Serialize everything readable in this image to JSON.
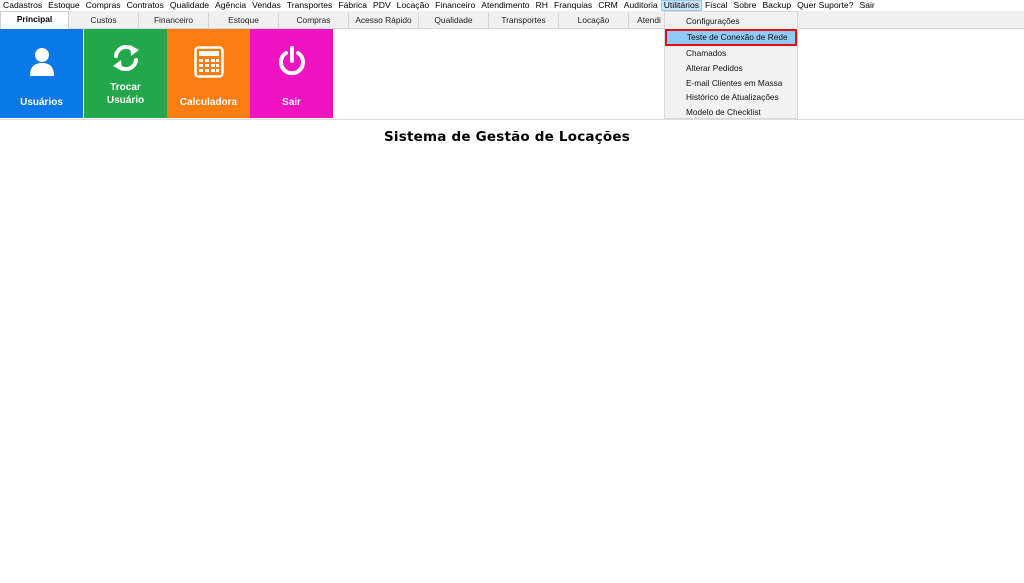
{
  "menu": [
    "Cadastros",
    "Estoque",
    "Compras",
    "Contratos",
    "Qualidade",
    "Agência",
    "Vendas",
    "Transportes",
    "Fábrica",
    "PDV",
    "Locação",
    "Financeiro",
    "Atendimento",
    "RH",
    "Franquias",
    "CRM",
    "Auditoria",
    "Utilitários",
    "Fiscal",
    "Sobre",
    "Backup",
    "Quer Suporte?",
    "Sair"
  ],
  "menu_active_index": 17,
  "tabs": [
    {
      "label": "Principal"
    },
    {
      "label": "Custos"
    },
    {
      "label": "Financeiro"
    },
    {
      "label": "Estoque"
    },
    {
      "label": "Compras"
    },
    {
      "label": "Acesso Rápido"
    },
    {
      "label": "Qualidade"
    },
    {
      "label": "Transportes"
    },
    {
      "label": "Locação"
    },
    {
      "label": "Atendi"
    }
  ],
  "tiles": [
    {
      "label": "Usuários",
      "color": "#0a78e6",
      "icon": "user-icon"
    },
    {
      "label": "Trocar Usuário",
      "color": "#22a74a",
      "icon": "refresh-icon"
    },
    {
      "label": "Calculadora",
      "color": "#fb7d10",
      "icon": "calculator-icon"
    },
    {
      "label": "Sair",
      "color": "#ef13c1",
      "icon": "power-icon"
    }
  ],
  "title": "Sistema de Gestão de Locações",
  "dropdown": {
    "items": [
      "Configurações",
      "Teste de Conexão de Rede",
      "Chamados",
      "Alterar Pedidos",
      "E-mail Clientes em Massa",
      "Histórico de Atualizações",
      "Modelo de Checklist"
    ],
    "highlighted_index": 1
  }
}
